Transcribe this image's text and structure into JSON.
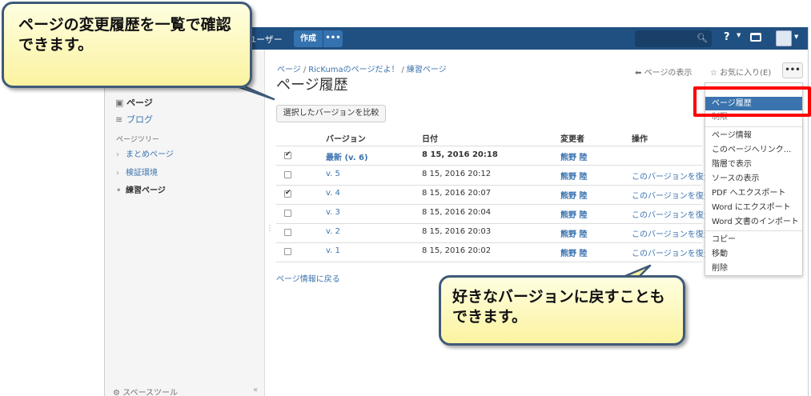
{
  "topbar": {
    "users_label": "ユーザー",
    "create_label": "作成",
    "more_label": "•••"
  },
  "sidebar": {
    "pages_label": "ページ",
    "blog_label": "ブログ",
    "tree_heading": "ページツリー",
    "tree": [
      "まとめページ",
      "検証環境",
      "練習ページ"
    ],
    "space_tools_label": "スペースツール",
    "collapse_label": "«"
  },
  "breadcrumb": [
    "ページ",
    "RicKumaのページだよ！",
    "練習ページ"
  ],
  "page": {
    "title": "ページ履歴",
    "view_page_label": "ページの表示",
    "favorite_label": "お気に入り(E)",
    "more_label": "•••",
    "compare_button": "選択したバージョンを比較",
    "back_link": "ページ情報に戻る"
  },
  "table": {
    "headers": [
      "バージョン",
      "日付",
      "変更者",
      "操作"
    ],
    "rows": [
      {
        "checked": true,
        "version": "最新 (v. 6)",
        "date": "8 15, 2016 20:18",
        "author": "熊野 陸",
        "action": ""
      },
      {
        "checked": false,
        "version": "v. 5",
        "date": "8 15, 2016 20:12",
        "author": "熊野 陸",
        "action": "このバージョンを復元"
      },
      {
        "checked": true,
        "version": "v. 4",
        "date": "8 15, 2016 20:07",
        "author": "熊野 陸",
        "action": "このバージョンを復元"
      },
      {
        "checked": false,
        "version": "v. 3",
        "date": "8 15, 2016 20:04",
        "author": "熊野 陸",
        "action": "このバージョンを復元"
      },
      {
        "checked": false,
        "version": "v. 2",
        "date": "8 15, 2016 20:03",
        "author": "熊野 陸",
        "action": "このバージョンを復元"
      },
      {
        "checked": false,
        "version": "v. 1",
        "date": "8 15, 2016 20:02",
        "author": "熊野 陸",
        "action": "このバージョンを復元"
      }
    ]
  },
  "menu": {
    "items": [
      "ページ履歴",
      "制限",
      "ページ情報",
      "このページへリンク...",
      "階層で表示",
      "ソースの表示",
      "PDF へエクスポート",
      "Word にエクスポート",
      "Word 文書のインポート",
      "コピー",
      "移動",
      "削除"
    ],
    "highlighted": "ページ履歴"
  },
  "callouts": {
    "top_left": "ページの変更履歴を一覧で確認できます。",
    "bottom_right": "好きなバージョンに戻すこともできます。"
  },
  "colors": {
    "header_bg": "#205081",
    "link": "#3b73af",
    "highlight": "#ff0000",
    "callout_bg": "#fbf3a0"
  }
}
